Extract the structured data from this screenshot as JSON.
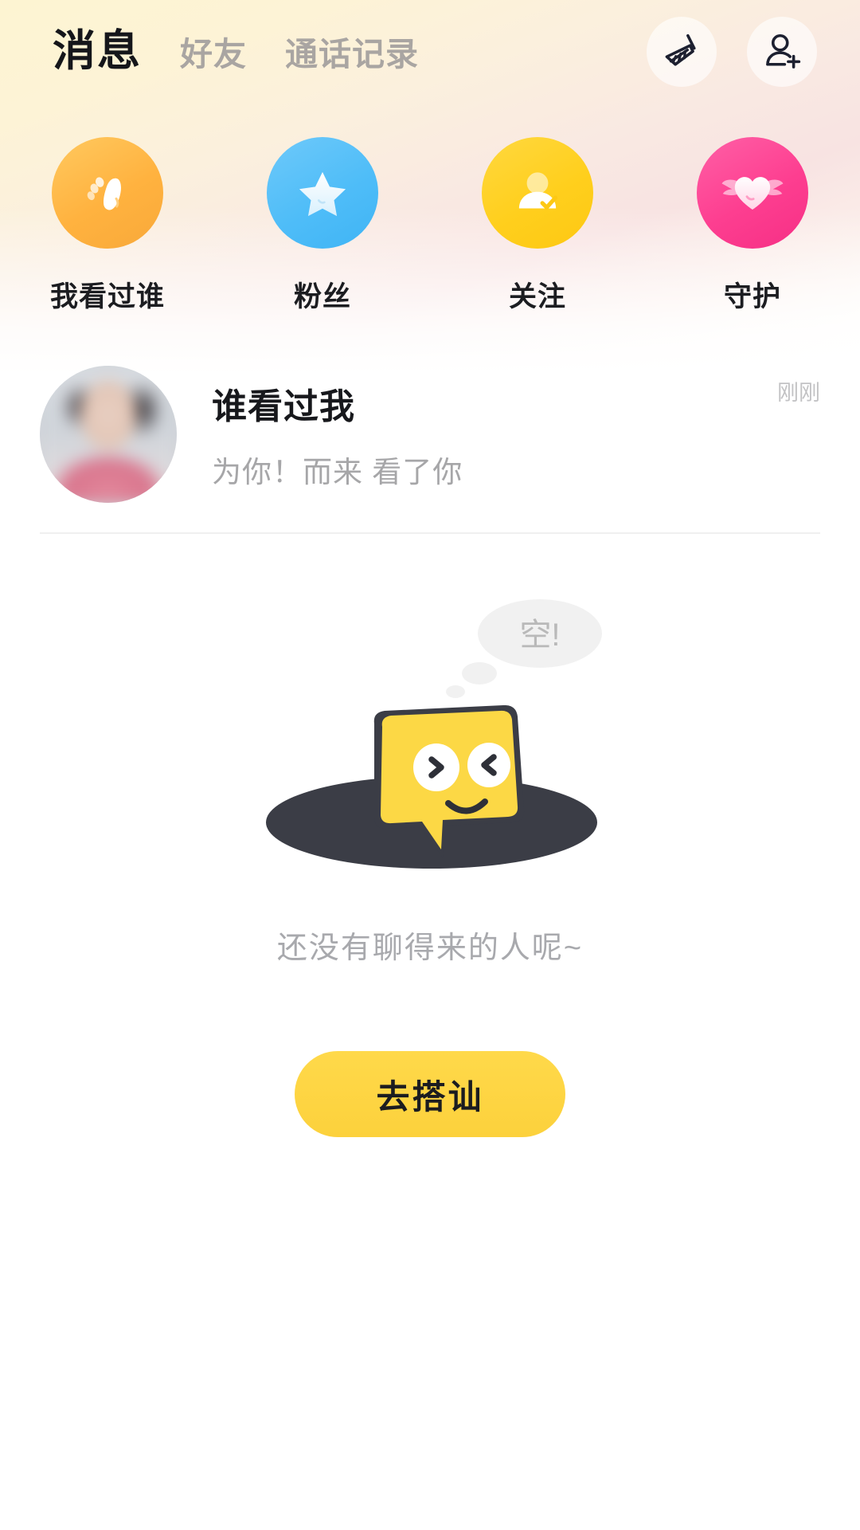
{
  "header": {
    "tabs": [
      {
        "label": "消息",
        "active": true
      },
      {
        "label": "好友",
        "active": false
      },
      {
        "label": "通话记录",
        "active": false
      }
    ],
    "actions": [
      {
        "name": "broom-icon",
        "label": "清理"
      },
      {
        "name": "add-user-icon",
        "label": "添加好友"
      }
    ]
  },
  "categories": [
    {
      "label": "我看过谁",
      "icon": "footprint-icon",
      "color": "#ffb23f"
    },
    {
      "label": "粉丝",
      "icon": "star-icon",
      "color": "#4fbdf8"
    },
    {
      "label": "关注",
      "icon": "person-check-icon",
      "color": "#ffcf1d"
    },
    {
      "label": "守护",
      "icon": "winged-heart-icon",
      "color": "#fd3e90"
    }
  ],
  "message_list": [
    {
      "title": "谁看过我",
      "subtitle": "为你！而来 看了你",
      "time": "刚刚",
      "avatar": "blurred-portrait"
    }
  ],
  "empty_state": {
    "bubble_text": "空!",
    "text": "还没有聊得来的人呢~",
    "cta_label": "去搭讪"
  },
  "theme": {
    "accent_yellow": "#fcd13c",
    "gradient_start": "#fdf4d2",
    "gradient_end": "#f8e3e2",
    "text_primary": "#17181c",
    "text_muted": "#a8a9ad"
  }
}
